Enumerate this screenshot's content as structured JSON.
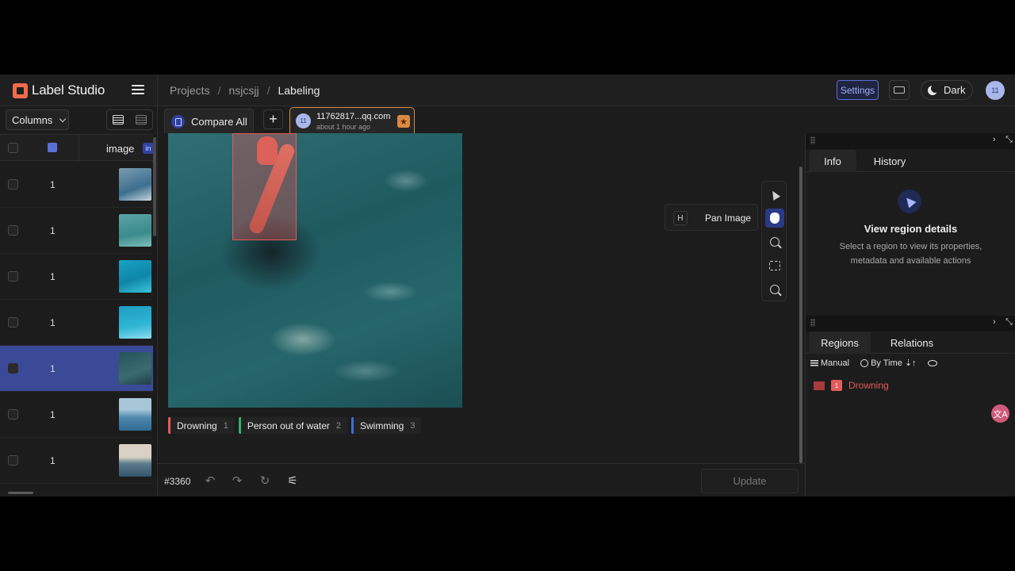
{
  "app": {
    "name": "Label Studio"
  },
  "breadcrumb": {
    "projects": "Projects",
    "project": "nsjcsjj",
    "current": "Labeling",
    "sep": "/"
  },
  "header": {
    "settings_label": "Settings",
    "theme_label": "Dark",
    "avatar_initials": "11"
  },
  "left": {
    "columns_label": "Columns",
    "head_label": "image",
    "head_badge": "in",
    "rows": [
      {
        "num": "1",
        "selected": false
      },
      {
        "num": "1",
        "selected": false
      },
      {
        "num": "1",
        "selected": false
      },
      {
        "num": "1",
        "selected": false
      },
      {
        "num": "1",
        "selected": true
      },
      {
        "num": "1",
        "selected": false
      },
      {
        "num": "1",
        "selected": false
      }
    ]
  },
  "tabs": {
    "compare_label": "Compare All",
    "plus_label": "+",
    "annotation": {
      "avatar": "11",
      "name": "11762817...qq.com",
      "time": "about 1 hour ago",
      "star": "★"
    }
  },
  "tools": {
    "tooltip_key": "H",
    "tooltip_text": "Pan Image"
  },
  "labels": [
    {
      "name": "Drowning",
      "key": "1",
      "color": "#e35b5b"
    },
    {
      "name": "Person out of water",
      "key": "2",
      "color": "#2fb36a"
    },
    {
      "name": "Swimming",
      "key": "3",
      "color": "#3b6fe0"
    }
  ],
  "bottom": {
    "task_id": "#3360",
    "undo": "↶",
    "redo": "↷",
    "reset": "↻",
    "tune": "⚟",
    "update_label": "Update"
  },
  "info_panel": {
    "tab_info": "Info",
    "tab_history": "History",
    "title": "View region details",
    "desc": "Select a region to view its properties, metadata and available actions"
  },
  "regions_panel": {
    "tab_regions": "Regions",
    "tab_relations": "Relations",
    "order_manual": "Manual",
    "order_time": "By Time",
    "sort_glyph": "⇣↑",
    "items": [
      {
        "num": "1",
        "label": "Drowning"
      }
    ]
  },
  "panel_ctrl": {
    "expand": "›",
    "collapse": "⤡"
  },
  "translate_glyph": "文A"
}
